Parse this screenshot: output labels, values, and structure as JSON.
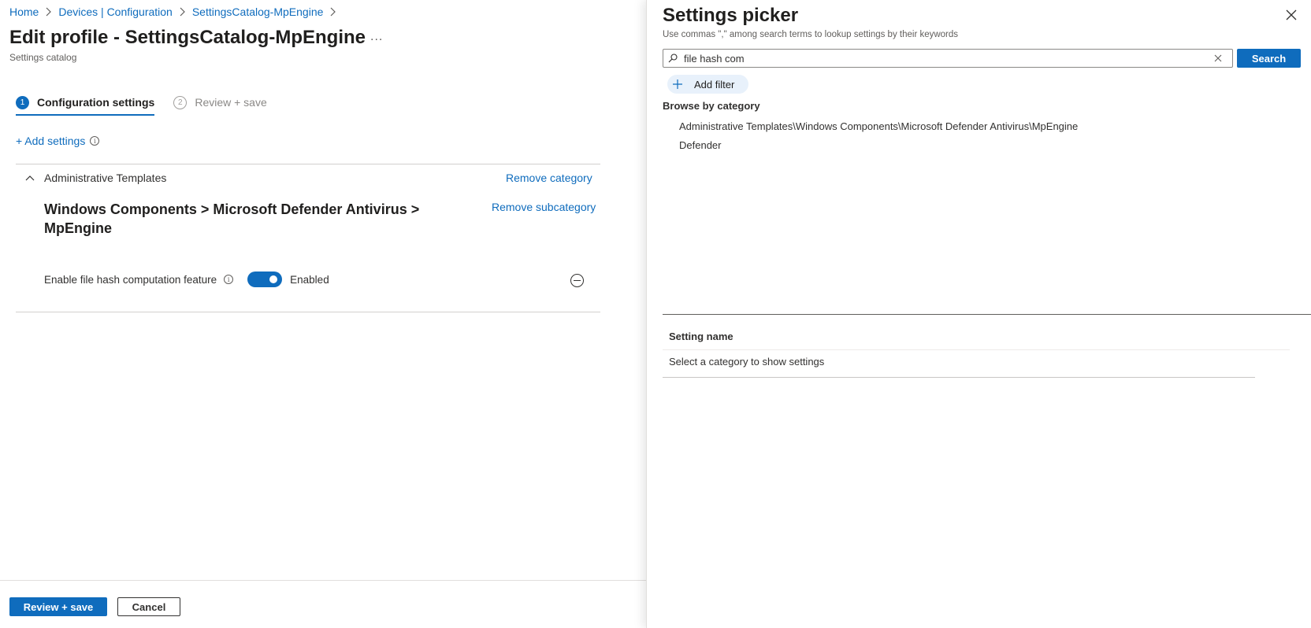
{
  "breadcrumb": {
    "items": [
      "Home",
      "Devices | Configuration",
      "SettingsCatalog-MpEngine"
    ]
  },
  "page": {
    "title": "Edit profile - SettingsCatalog-MpEngine",
    "more": "...",
    "subtitle": "Settings catalog"
  },
  "steps": [
    {
      "number": "1",
      "label": "Configuration settings",
      "active": true
    },
    {
      "number": "2",
      "label": "Review + save",
      "active": false
    }
  ],
  "add_settings": {
    "label": "+ Add settings",
    "info_icon": "info-icon"
  },
  "category": {
    "name": "Administrative Templates",
    "remove_label": "Remove category",
    "subcategory": {
      "title": "Windows Components > Microsoft Defender Antivirus > MpEngine",
      "remove_label": "Remove subcategory"
    },
    "setting": {
      "name": "Enable file hash computation feature",
      "value": "Enabled",
      "toggle_on": true
    }
  },
  "footer": {
    "primary": "Review + save",
    "secondary": "Cancel"
  },
  "picker": {
    "title": "Settings picker",
    "hint": "Use commas \",\" among search terms to lookup settings by their keywords",
    "search_value": "file hash com",
    "search_button": "Search",
    "add_filter": "Add filter",
    "browse_label": "Browse by category",
    "categories": [
      "Administrative Templates\\Windows Components\\Microsoft Defender Antivirus\\MpEngine",
      "Defender"
    ],
    "table": {
      "header": "Setting name",
      "empty_text": "Select a category to show settings"
    }
  },
  "colors": {
    "accent": "#0f6cbd",
    "text": "#323130",
    "muted": "#605e5c"
  }
}
